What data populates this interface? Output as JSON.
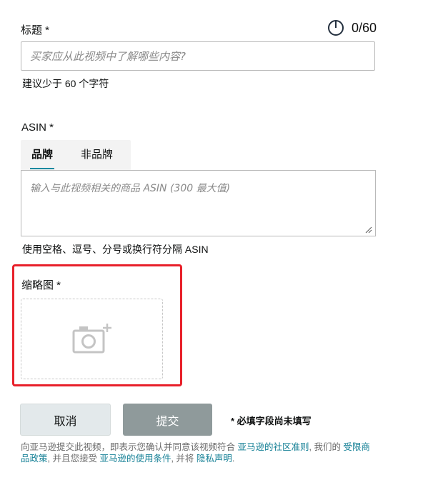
{
  "title_field": {
    "label": "标题 *",
    "counter": "0/60",
    "placeholder": "买家应从此视频中了解哪些内容?",
    "hint": "建议少于 60 个字符"
  },
  "asin_field": {
    "label": "ASIN *",
    "tabs": [
      {
        "label": "品牌",
        "active": true
      },
      {
        "label": "非品牌",
        "active": false
      }
    ],
    "placeholder": "输入与此视频相关的商品 ASIN (300 最大值)",
    "hint": "使用空格、逗号、分号或换行符分隔 ASIN"
  },
  "thumbnail_field": {
    "label": "缩略图 *",
    "icon": "camera-add-icon",
    "highlight_color": "#e8202a"
  },
  "actions": {
    "cancel_label": "取消",
    "submit_label": "提交",
    "required_note": "* 必填字段尚未填写"
  },
  "footer": {
    "text_1": "向亚马逊提交此视频，即表示您确认并同意该视频符合 ",
    "link_1": "亚马逊的社区准则",
    "text_2": ", 我们的 ",
    "link_2": "受限商品政策",
    "text_3": ", 并且您接受 ",
    "link_3": "亚马逊的使用条件",
    "text_4": ", 并将 ",
    "link_4": "隐私声明",
    "text_5": "."
  },
  "colors": {
    "accent": "#1b8aa0",
    "link": "#137f95",
    "submit_disabled": "#8f9a9b"
  }
}
